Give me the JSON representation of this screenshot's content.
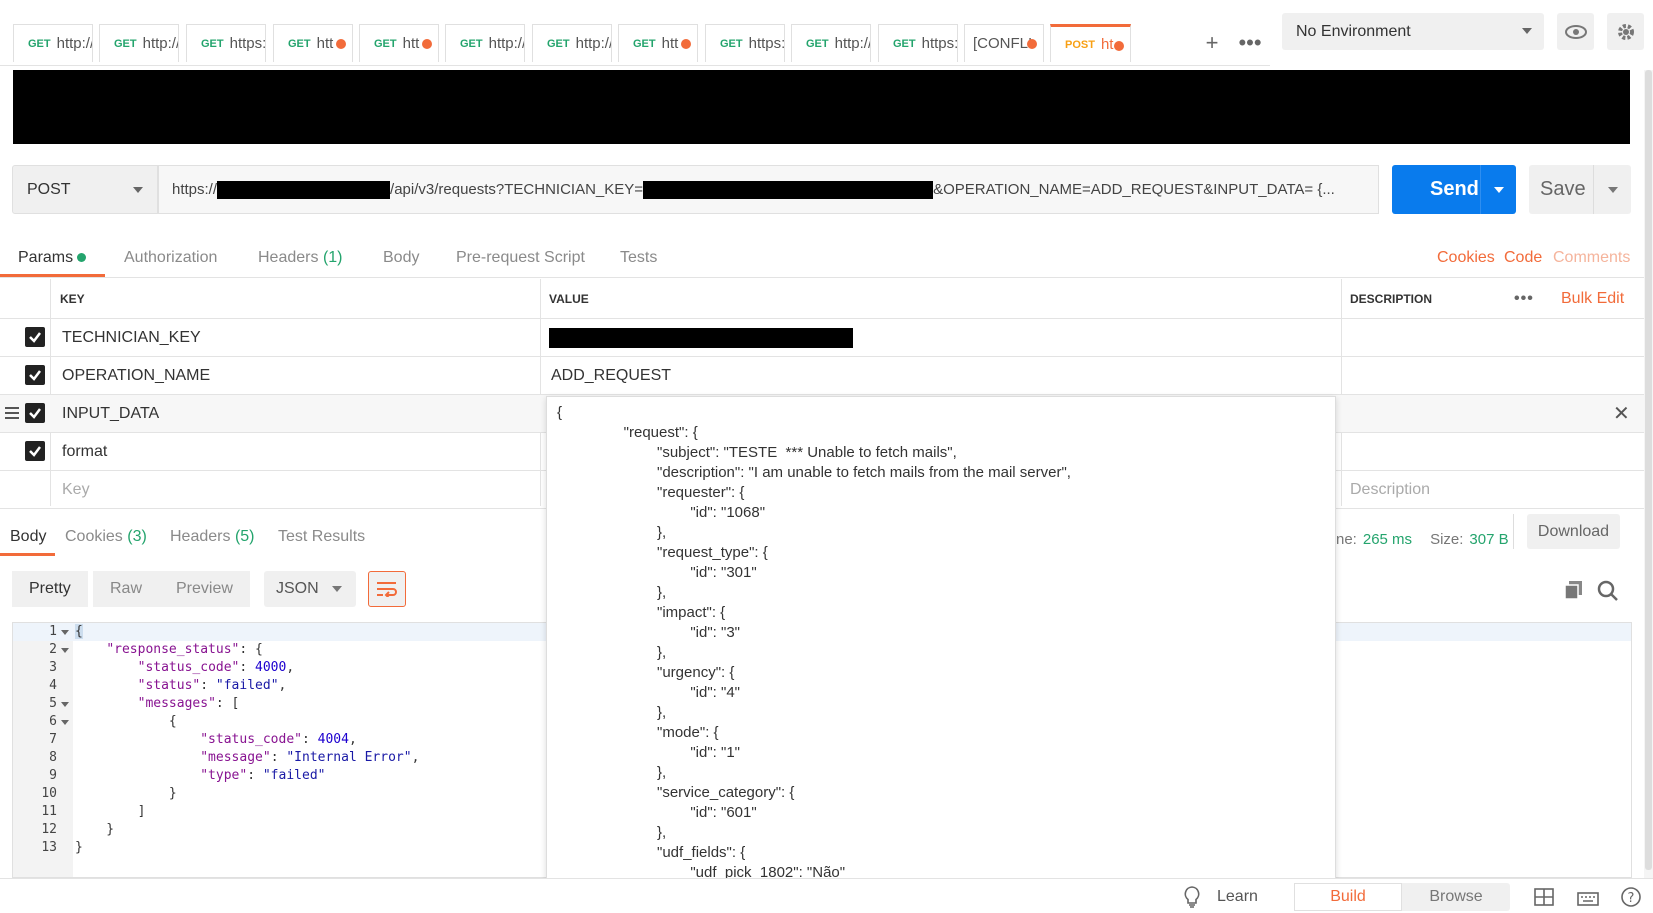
{
  "tabs": [
    {
      "method": "GET",
      "url": "http://",
      "dirty": false
    },
    {
      "method": "GET",
      "url": "http://",
      "dirty": false
    },
    {
      "method": "GET",
      "url": "https:/",
      "dirty": false
    },
    {
      "method": "GET",
      "url": "htt",
      "dirty": true
    },
    {
      "method": "GET",
      "url": "htt",
      "dirty": true
    },
    {
      "method": "GET",
      "url": "http://",
      "dirty": false
    },
    {
      "method": "GET",
      "url": "http://",
      "dirty": false
    },
    {
      "method": "GET",
      "url": "htt",
      "dirty": true
    },
    {
      "method": "GET",
      "url": "https:/",
      "dirty": false
    },
    {
      "method": "GET",
      "url": "http://",
      "dirty": false
    },
    {
      "method": "GET",
      "url": "https:/",
      "dirty": false
    },
    {
      "method": "",
      "url": "[CONFLI",
      "dirty": true
    },
    {
      "method": "POST",
      "url": "ht",
      "dirty": true,
      "active": true
    }
  ],
  "environment": {
    "selected": "No Environment"
  },
  "request": {
    "method": "POST",
    "url_prefix": "https://",
    "url_mid": "/api/v3/requests?TECHNICIAN_KEY=",
    "url_suffix": "&OPERATION_NAME=ADD_REQUEST&INPUT_DATA= {...",
    "send_label": "Send",
    "save_label": "Save"
  },
  "request_tabs": {
    "params": "Params",
    "authorization": "Authorization",
    "headers": "Headers",
    "headers_count": "(1)",
    "body": "Body",
    "prerequest": "Pre-request Script",
    "tests": "Tests",
    "cookies": "Cookies",
    "code": "Code",
    "comments": "Comments"
  },
  "params_table": {
    "col_key": "KEY",
    "col_value": "VALUE",
    "col_desc": "DESCRIPTION",
    "bulk_edit": "Bulk Edit",
    "rows": [
      {
        "key": "TECHNICIAN_KEY",
        "value": ""
      },
      {
        "key": "OPERATION_NAME",
        "value": "ADD_REQUEST"
      },
      {
        "key": "INPUT_DATA",
        "value": ""
      },
      {
        "key": "format",
        "value": ""
      }
    ],
    "key_placeholder": "Key",
    "desc_placeholder": "Description"
  },
  "tooltip_lines": [
    "{",
    "                \"request\": {",
    "                        \"subject\": \"TESTE  *** Unable to fetch mails\",",
    "                        \"description\": \"I am unable to fetch mails from the mail server\",",
    "                        \"requester\": {",
    "                                \"id\": \"1068\"",
    "                        },",
    "                        \"request_type\": {",
    "                                \"id\": \"301\"",
    "                        },",
    "                        \"impact\": {",
    "                                \"id\": \"3\"",
    "                        },",
    "                        \"urgency\": {",
    "                                \"id\": \"4\"",
    "                        },",
    "                        \"mode\": {",
    "                                \"id\": \"1\"",
    "                        },",
    "                        \"service_category\": {",
    "                                \"id\": \"601\"",
    "                        },",
    "                        \"udf_fields\": {",
    "                                \"udf_pick_1802\": \"Não\""
  ],
  "response_tabs": {
    "body": "Body",
    "cookies": "Cookies",
    "cookies_count": "(3)",
    "headers": "Headers",
    "headers_count": "(5)",
    "test_results": "Test Results"
  },
  "response_stats": {
    "time_label": "ne:",
    "time_value": "265 ms",
    "size_label": "Size:",
    "size_value": "307 B",
    "download": "Download"
  },
  "view_modes": {
    "pretty": "Pretty",
    "raw": "Raw",
    "preview": "Preview",
    "format": "JSON"
  },
  "code_lines": [
    {
      "n": "1",
      "fold": true,
      "html": "<span style='background:#cde'>{</span>"
    },
    {
      "n": "2",
      "fold": true,
      "html": "    <span class='k'>\"response_status\"</span>: {"
    },
    {
      "n": "3",
      "fold": false,
      "html": "        <span class='k'>\"status_code\"</span>: <span class='n'>4000</span>,"
    },
    {
      "n": "4",
      "fold": false,
      "html": "        <span class='k'>\"status\"</span>: <span class='s'>\"failed\"</span>,"
    },
    {
      "n": "5",
      "fold": true,
      "html": "        <span class='k'>\"messages\"</span>: ["
    },
    {
      "n": "6",
      "fold": true,
      "html": "            {"
    },
    {
      "n": "7",
      "fold": false,
      "html": "                <span class='k'>\"status_code\"</span>: <span class='n'>4004</span>,"
    },
    {
      "n": "8",
      "fold": false,
      "html": "                <span class='k'>\"message\"</span>: <span class='s'>\"Internal Error\"</span>,"
    },
    {
      "n": "9",
      "fold": false,
      "html": "                <span class='k'>\"type\"</span>: <span class='s'>\"failed\"</span>"
    },
    {
      "n": "10",
      "fold": false,
      "html": "            }"
    },
    {
      "n": "11",
      "fold": false,
      "html": "        ]"
    },
    {
      "n": "12",
      "fold": false,
      "html": "    }"
    },
    {
      "n": "13",
      "fold": false,
      "html": "}"
    }
  ],
  "footer": {
    "learn": "Learn",
    "build": "Build",
    "browse": "Browse"
  },
  "colors": {
    "accent": "#f26b3a",
    "send": "#097bed",
    "get": "#24a46d",
    "post": "#f8a014"
  }
}
